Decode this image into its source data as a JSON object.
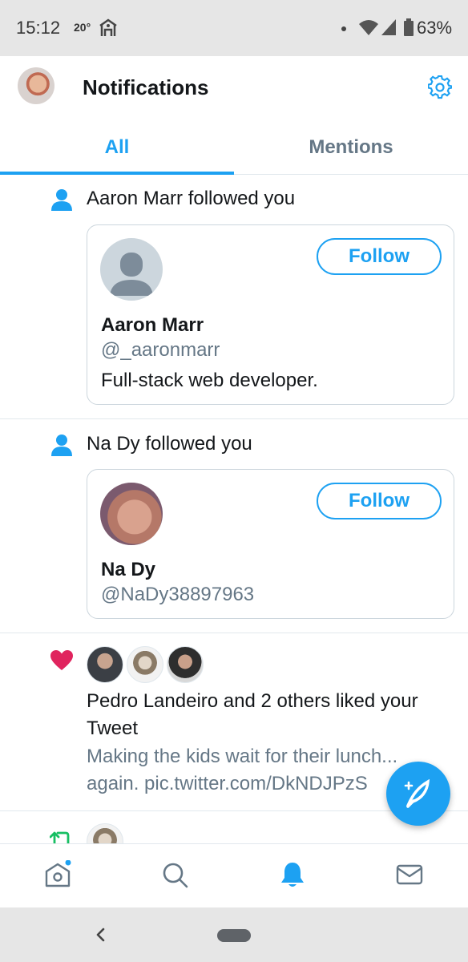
{
  "status_bar": {
    "time": "15:12",
    "temperature": "20°",
    "battery": "63%"
  },
  "header": {
    "title": "Notifications",
    "settings_icon": "gear-icon"
  },
  "tabs": [
    {
      "label": "All",
      "active": true
    },
    {
      "label": "Mentions",
      "active": false
    }
  ],
  "notifications": [
    {
      "type": "follow",
      "icon": "person-icon",
      "text": "Aaron Marr followed you",
      "user": {
        "name": "Aaron Marr",
        "handle": "@_aaronmarr",
        "bio": "Full-stack web developer.",
        "follow_label": "Follow"
      }
    },
    {
      "type": "follow",
      "icon": "person-icon",
      "text": "Na Dy followed you",
      "user": {
        "name": "Na Dy",
        "handle": "@NaDy38897963",
        "follow_label": "Follow"
      }
    },
    {
      "type": "like",
      "icon": "heart-icon",
      "text_line1": "Pedro Landeiro and 2 others liked your",
      "text_line2": "Tweet",
      "tweet_line1": "Making the kids wait for their lunch...",
      "tweet_line2": "again. pic.twitter.com/DkNDJPzS"
    },
    {
      "type": "retweet",
      "icon": "retweet-icon"
    }
  ],
  "bottom_nav": [
    "home-icon",
    "search-icon",
    "bell-icon",
    "mail-icon"
  ],
  "colors": {
    "accent": "#1da1f2",
    "like": "#e0245e",
    "retweet": "#17bf63",
    "secondary_text": "#657786"
  }
}
